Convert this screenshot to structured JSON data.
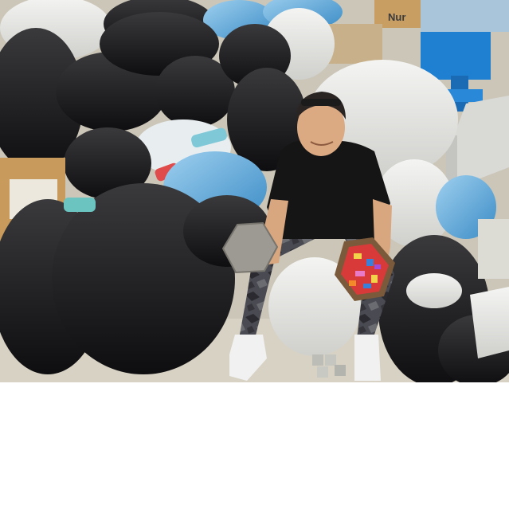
{
  "photo": {
    "box_label": "Nur"
  }
}
